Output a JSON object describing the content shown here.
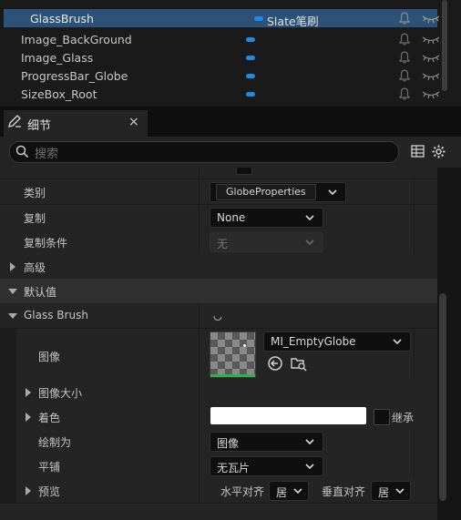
{
  "variables": {
    "rows": [
      {
        "name": "GlassBrush",
        "type": "Slate笔刷",
        "selected": true
      },
      {
        "name": "Image_BackGround",
        "type": "",
        "selected": false
      },
      {
        "name": "Image_Glass",
        "type": "",
        "selected": false
      },
      {
        "name": "ProgressBar_Globe",
        "type": "",
        "selected": false
      },
      {
        "name": "SizeBox_Root",
        "type": "",
        "selected": false
      }
    ]
  },
  "details": {
    "tab_label": "细节",
    "close_glyph": "×",
    "search_placeholder": "搜索"
  },
  "props": {
    "category_label": "类别",
    "category_value": "GlobeProperties",
    "replication_label": "复制",
    "replication_value": "None",
    "replication_condition_label": "复制条件",
    "replication_condition_value": "无",
    "advanced_label": "高级",
    "default_value_label": "默认值",
    "glass_brush_label": "Glass Brush",
    "image_label": "图像",
    "image_asset": "MI_EmptyGlobe",
    "image_size_label": "图像大小",
    "tint_label": "着色",
    "inherit_label": "继承",
    "draw_as_label": "绘制为",
    "draw_as_value": "图像",
    "tiling_label": "平铺",
    "tiling_value": "无瓦片",
    "preview_label": "预览",
    "halign_label": "水平对齐",
    "halign_value": "居",
    "valign_label": "垂直对齐",
    "valign_value": "居"
  },
  "colors": {
    "accent": "#1f8be5",
    "selected_row": "#2c5278",
    "panel": "#242424",
    "category": "#2f2f2f"
  }
}
